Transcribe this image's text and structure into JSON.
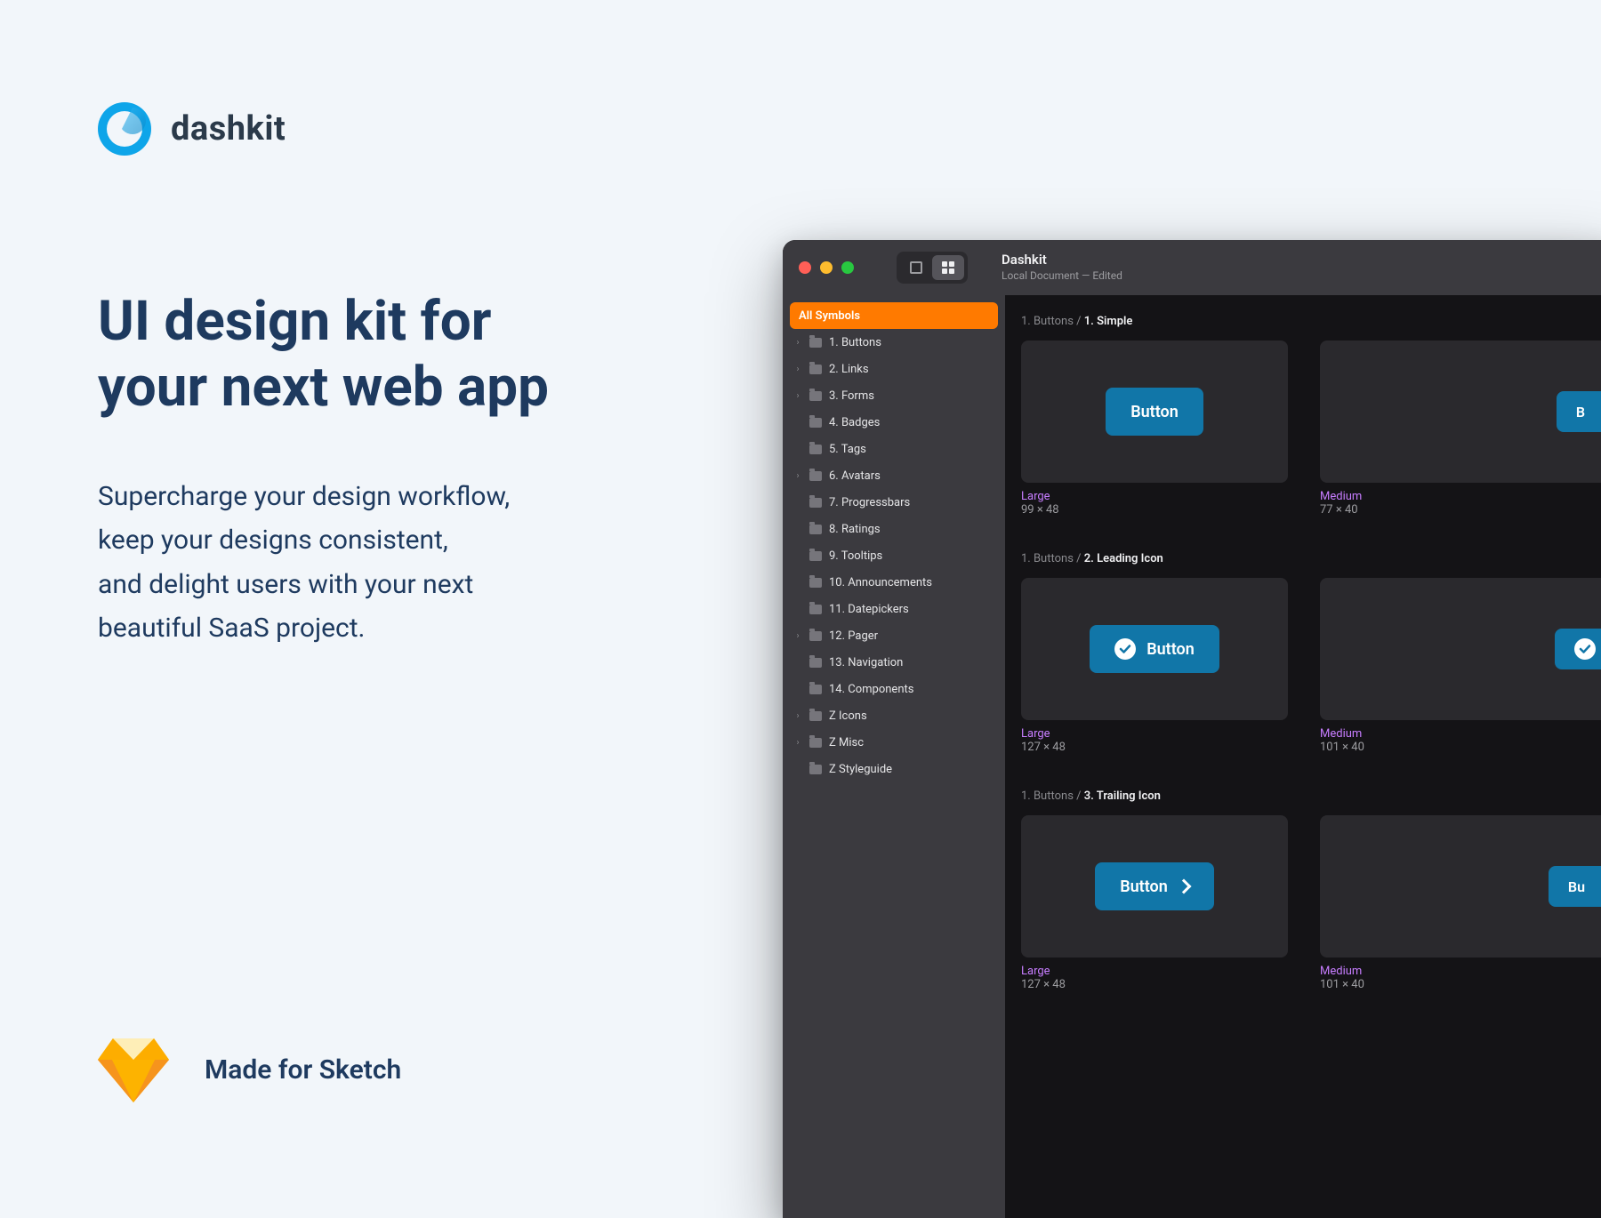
{
  "brand": {
    "name": "dashkit"
  },
  "headline_l1": "UI design kit for",
  "headline_l2": "your next web app",
  "sub_l1": "Supercharge your design workflow,",
  "sub_l2": "keep your designs consistent,",
  "sub_l3": "and delight users with your next",
  "sub_l4": "beautiful SaaS project.",
  "made_for": "Made for Sketch",
  "window": {
    "doc_title": "Dashkit",
    "doc_sub": "Local Document — Edited"
  },
  "sidebar": {
    "active_label": "All Symbols",
    "items": [
      {
        "label": "1. Buttons",
        "expandable": true
      },
      {
        "label": "2. Links",
        "expandable": true
      },
      {
        "label": "3. Forms",
        "expandable": true
      },
      {
        "label": "4. Badges",
        "expandable": false
      },
      {
        "label": "5. Tags",
        "expandable": false
      },
      {
        "label": "6. Avatars",
        "expandable": true
      },
      {
        "label": "7. Progressbars",
        "expandable": false
      },
      {
        "label": "8. Ratings",
        "expandable": false
      },
      {
        "label": "9. Tooltips",
        "expandable": false
      },
      {
        "label": "10. Announcements",
        "expandable": false
      },
      {
        "label": "11. Datepickers",
        "expandable": false
      },
      {
        "label": "12. Pager",
        "expandable": true
      },
      {
        "label": "13. Navigation",
        "expandable": false
      },
      {
        "label": "14. Components",
        "expandable": false
      },
      {
        "label": "Z Icons",
        "expandable": true
      },
      {
        "label": "Z Misc",
        "expandable": true
      },
      {
        "label": "Z Styleguide",
        "expandable": false
      }
    ]
  },
  "sections": [
    {
      "crumb_prefix": "1. Buttons / ",
      "crumb_strong": "1. Simple",
      "artboards": [
        {
          "size": "lg",
          "button_label": "Button",
          "name": "Large",
          "dim": "99 × 48",
          "icon": "none"
        },
        {
          "size": "md",
          "button_label": "B",
          "name": "Medium",
          "dim": "77 × 40",
          "icon": "none",
          "cut": true
        }
      ]
    },
    {
      "crumb_prefix": "1. Buttons / ",
      "crumb_strong": "2. Leading Icon",
      "artboards": [
        {
          "size": "lg",
          "button_label": "Button",
          "name": "Large",
          "dim": "127 × 48",
          "icon": "check-leading"
        },
        {
          "size": "md",
          "button_label": "",
          "name": "Medium",
          "dim": "101 × 40",
          "icon": "check-leading",
          "cut": true
        }
      ]
    },
    {
      "crumb_prefix": "1. Buttons / ",
      "crumb_strong": "3. Trailing Icon",
      "artboards": [
        {
          "size": "lg",
          "button_label": "Button",
          "name": "Large",
          "dim": "127 × 48",
          "icon": "chev-trailing"
        },
        {
          "size": "md",
          "button_label": "Bu",
          "name": "Medium",
          "dim": "101 × 40",
          "icon": "none",
          "cut": true
        }
      ]
    }
  ]
}
